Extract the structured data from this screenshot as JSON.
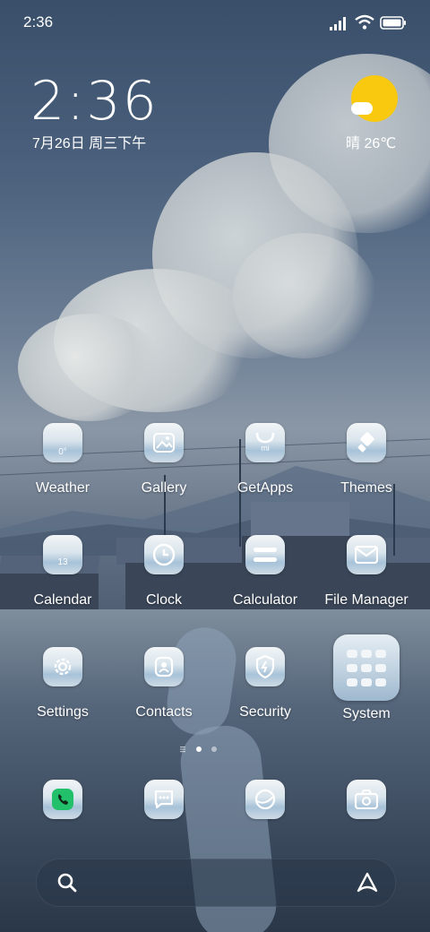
{
  "status_bar": {
    "time": "2:36"
  },
  "clock_widget": {
    "time": "2:36",
    "date": "7月26日 周三下午"
  },
  "weather_widget": {
    "text": "晴 26℃"
  },
  "apps": [
    {
      "label": "Weather",
      "icon": "weather-icon",
      "badge": "0°"
    },
    {
      "label": "Gallery",
      "icon": "gallery-icon"
    },
    {
      "label": "GetApps",
      "icon": "getapps-icon",
      "badge": "mi"
    },
    {
      "label": "Themes",
      "icon": "themes-icon"
    },
    {
      "label": "Calendar",
      "icon": "calendar-icon",
      "badge": "13"
    },
    {
      "label": "Clock",
      "icon": "clock-icon"
    },
    {
      "label": "Calculator",
      "icon": "calculator-icon"
    },
    {
      "label": "File Manager",
      "icon": "file-manager-icon"
    },
    {
      "label": "Settings",
      "icon": "settings-icon"
    },
    {
      "label": "Contacts",
      "icon": "contacts-icon"
    },
    {
      "label": "Security",
      "icon": "security-icon"
    }
  ],
  "folder": {
    "label": "System"
  },
  "dock": [
    {
      "icon": "phone-icon"
    },
    {
      "icon": "messages-icon"
    },
    {
      "icon": "browser-icon"
    },
    {
      "icon": "camera-icon"
    }
  ],
  "colors": {
    "sun": "#f8c90f",
    "phone_green": "#22c06a"
  }
}
